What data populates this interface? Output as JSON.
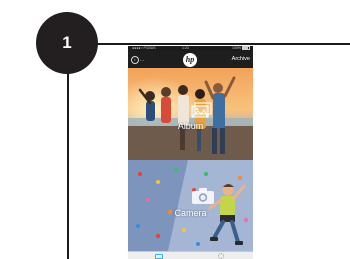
{
  "callout": {
    "number": "1"
  },
  "status_bar": {
    "carrier": "●●●●○ PCBUS",
    "time": "1:23",
    "battery": "100%"
  },
  "header": {
    "info_label": "i",
    "info_text": "...",
    "logo_text": "hp",
    "archive_label": "Archive"
  },
  "panels": {
    "album_label": "Album",
    "camera_label": "Camera"
  },
  "icons": {
    "album": "photo-gallery-icon",
    "camera": "camera-icon",
    "nav_gallery": "gallery-icon",
    "nav_settings": "gear-icon"
  },
  "colors": {
    "callout": "#231f20",
    "header": "#1e1e1e",
    "accent": "#3bb3e3"
  }
}
